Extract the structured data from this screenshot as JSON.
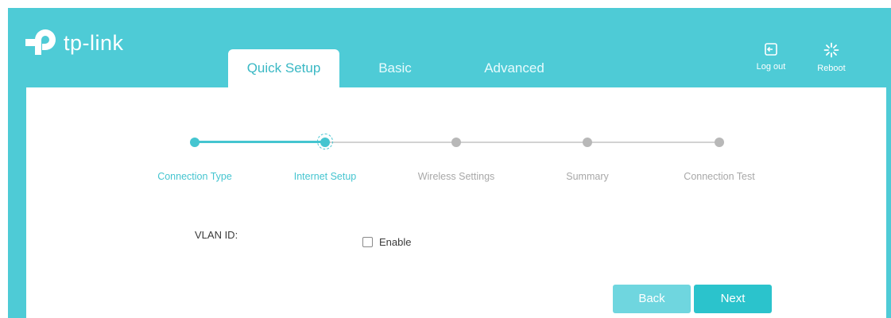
{
  "brand": {
    "name": "tp-link"
  },
  "tabs": [
    {
      "label": "Quick Setup",
      "active": true
    },
    {
      "label": "Basic",
      "active": false
    },
    {
      "label": "Advanced",
      "active": false
    }
  ],
  "header_actions": {
    "logout_label": "Log out",
    "reboot_label": "Reboot"
  },
  "wizard": {
    "steps": [
      {
        "label": "Connection Type",
        "state": "done"
      },
      {
        "label": "Internet Setup",
        "state": "current"
      },
      {
        "label": "Wireless Settings",
        "state": "pending"
      },
      {
        "label": "Summary",
        "state": "pending"
      },
      {
        "label": "Connection Test",
        "state": "pending"
      }
    ]
  },
  "form": {
    "vlan_label": "VLAN ID:",
    "enable_label": "Enable",
    "enable_checked": false
  },
  "buttons": {
    "back": "Back",
    "next": "Next"
  },
  "colors": {
    "accent": "#4ecbd6",
    "accent_dark": "#2bc3cc",
    "inactive": "#b8b8b8"
  }
}
